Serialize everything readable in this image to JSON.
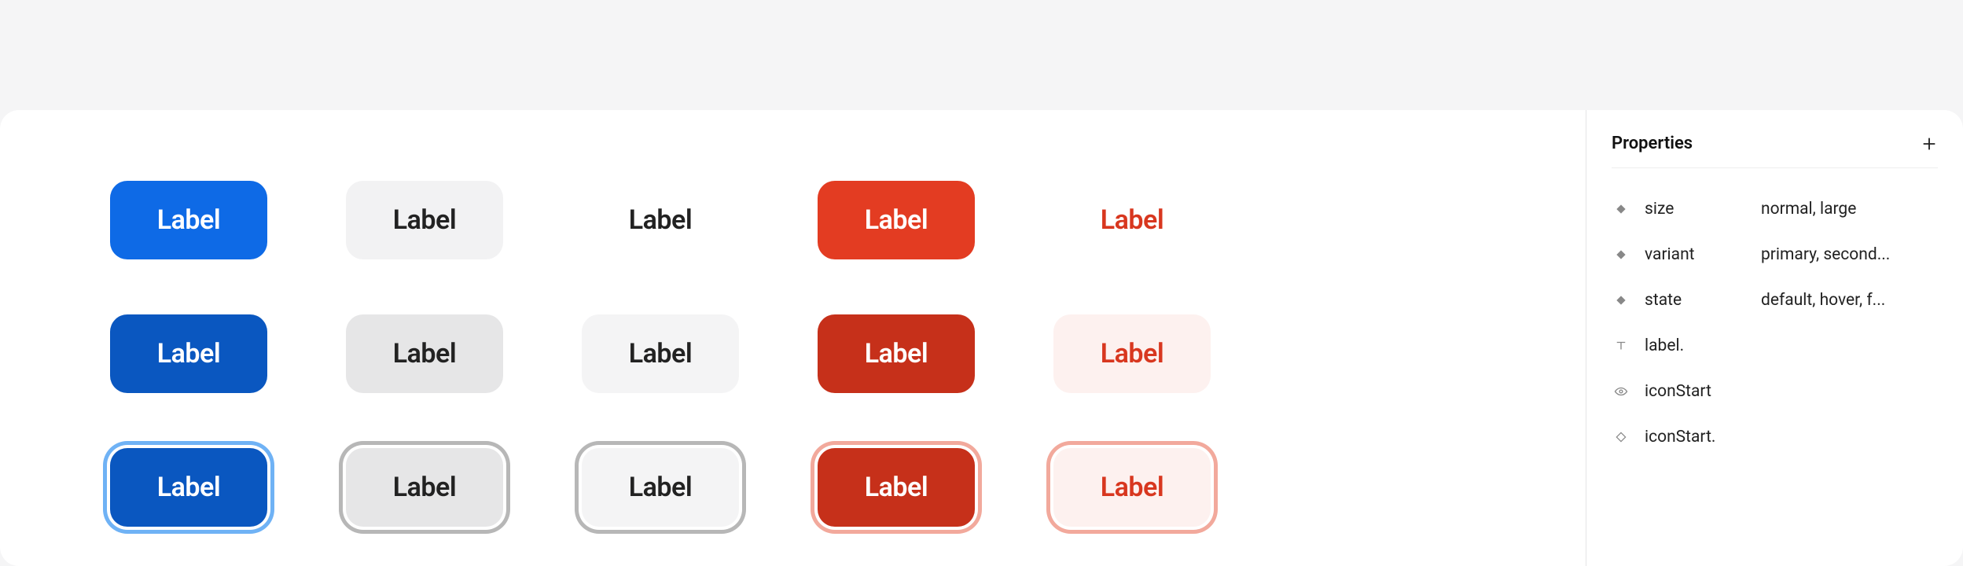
{
  "topbar": {},
  "buttons": {
    "label": "Label",
    "rows": [
      {
        "state": "default",
        "variants": [
          "primary",
          "secondary",
          "ghost",
          "danger",
          "danger-ghost"
        ]
      },
      {
        "state": "hover",
        "variants": [
          "primary",
          "secondary",
          "ghost",
          "danger",
          "danger-ghost"
        ]
      },
      {
        "state": "focus",
        "variants": [
          "primary",
          "secondary",
          "ghost",
          "danger",
          "danger-ghost"
        ]
      }
    ]
  },
  "panel": {
    "title": "Properties",
    "properties": [
      {
        "icon": "diamond-filled",
        "key": "size",
        "value": "normal, large"
      },
      {
        "icon": "diamond-filled",
        "key": "variant",
        "value": "primary, second..."
      },
      {
        "icon": "diamond-filled",
        "key": "state",
        "value": "default, hover, f..."
      },
      {
        "icon": "text",
        "key": "label.",
        "value": ""
      },
      {
        "icon": "eye",
        "key": "iconStart",
        "value": ""
      },
      {
        "icon": "diamond-outline",
        "key": "iconStart.",
        "value": ""
      }
    ]
  }
}
